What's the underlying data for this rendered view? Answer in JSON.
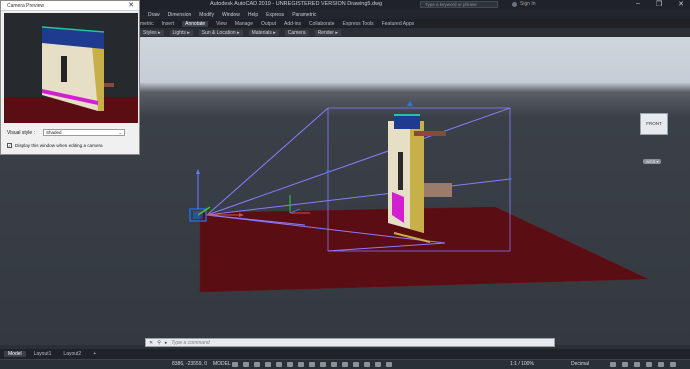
{
  "window": {
    "title": "Autodesk AutoCAD 2019 - UNREGISTERED VERSION   Drawing5.dwg",
    "search_placeholder": "Type a keyword or phrase",
    "signin_label": "Sign In",
    "minimize": "–",
    "maximize": "❐",
    "close": "✕"
  },
  "menubar": {
    "items": [
      "Draw",
      "Dimension",
      "Modify",
      "Window",
      "Help",
      "Express",
      "Parametric"
    ]
  },
  "ribbon_tabs": {
    "items": [
      "metric",
      "Insert",
      "Annotate",
      "View",
      "Manage",
      "Output",
      "Add-ins",
      "Collaborate",
      "Express Tools",
      "Featured Apps"
    ],
    "active_index": 2
  },
  "ribbon_panels": {
    "items": [
      "Styles ▸",
      "Lights ▸",
      "Sun & Location ▸",
      "Materials ▸",
      "Camera",
      "Render ▸"
    ]
  },
  "viewcube": {
    "face_label": "FRONT",
    "wcs_label": "WCS ▾"
  },
  "camera_preview": {
    "title": "Camera Preview",
    "close": "✕",
    "visual_style_label": "Visual style :",
    "visual_style_value": "Shaded",
    "checkbox_checked": "✓",
    "checkbox_label": "Display this window when editing a camera"
  },
  "command_line": {
    "close_icon": "✕",
    "tool_icon": "⚲",
    "prompt_icon": "▸",
    "placeholder": "Type a command"
  },
  "layout_tabs": {
    "items": [
      "Model",
      "Layout1",
      "Layout2",
      "+"
    ],
    "active_index": 0
  },
  "status_bar": {
    "coordinates": "8386, -23559, 0",
    "space": "MODEL",
    "annotation_scale": "1:1 / 100%",
    "units": "Decimal"
  },
  "colors": {
    "ground": "#5a0d12",
    "frustum": "#8a7bff",
    "wall": "#e7dfc5",
    "wall_side": "#c7b04a",
    "roof": "#1f3b8f",
    "accent_magenta": "#d21fd2",
    "camera_glyph": "#1e6be0"
  }
}
